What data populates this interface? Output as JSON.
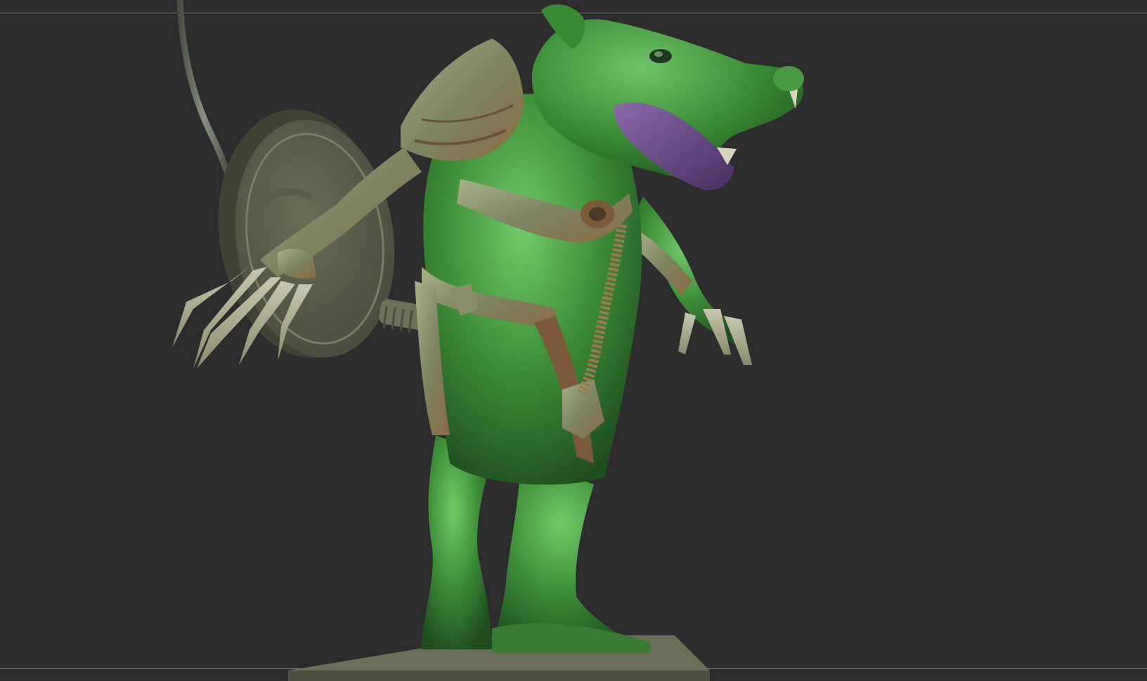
{
  "viewport": {
    "background": "#2c2c2c",
    "frame_line_color": "#7a7a7a"
  },
  "model": {
    "subject": "sculpted-rat-warrior",
    "skin_color": "#3f8f3a",
    "skin_highlight": "#6fc36a",
    "armor_color": "#8a8f6a",
    "armor_trim": "#7a5a3a",
    "mouth_color": "#6a4a8a",
    "shield_color": "#5a5e48",
    "base_color": "#6b6e58"
  }
}
